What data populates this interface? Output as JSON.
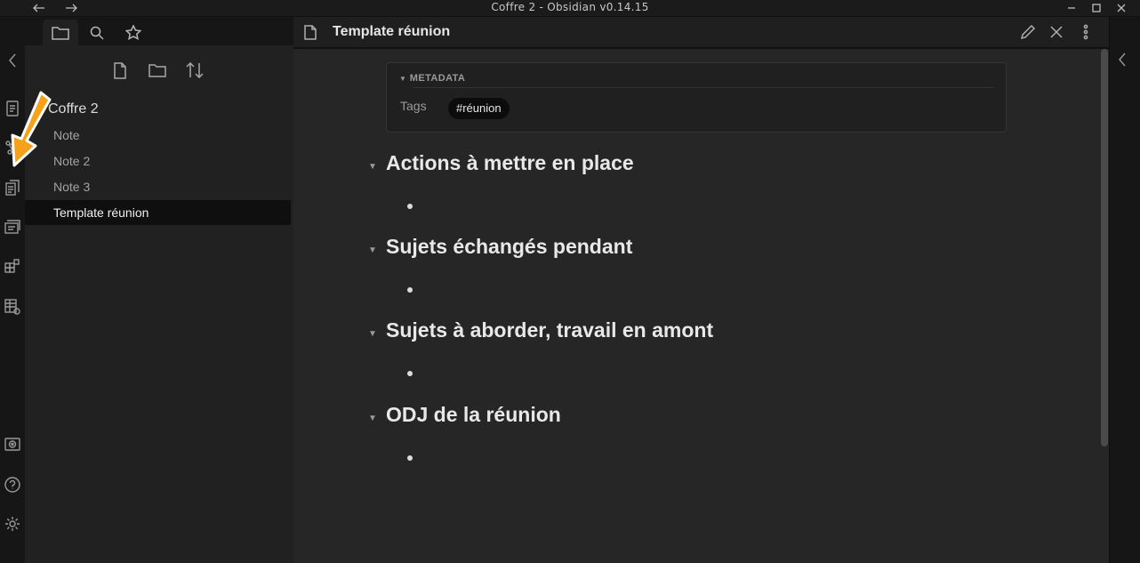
{
  "window": {
    "title": "Coffre 2 - Obsidian v0.14.15"
  },
  "sidebar": {
    "vault_name": "Coffre 2",
    "files": [
      {
        "label": "Note"
      },
      {
        "label": "Note 2"
      },
      {
        "label": "Note 3"
      },
      {
        "label": "Template réunion",
        "active": true
      }
    ]
  },
  "editor": {
    "title": "Template réunion",
    "metadata": {
      "header": "METADATA",
      "key": "Tags",
      "tag": "#réunion"
    },
    "headings": [
      "Actions à mettre en place",
      "Sujets échangés pendant",
      "Sujets à aborder, travail en amont",
      "ODJ de la réunion"
    ]
  },
  "colors": {
    "arrow": "#f5a21a",
    "background": "#262626",
    "sidebar": "#212121"
  }
}
